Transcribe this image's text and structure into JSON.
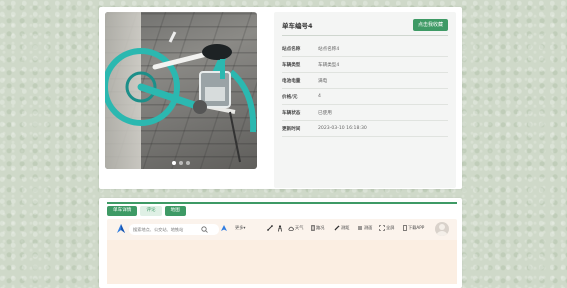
{
  "detail": {
    "title": "单车编号4",
    "collect_label": "点击我收藏",
    "fields": [
      {
        "label": "站点名称",
        "value": "站点名称4"
      },
      {
        "label": "车辆类型",
        "value": "车辆类型4"
      },
      {
        "label": "电池电量",
        "value": "满电"
      },
      {
        "label": "价格/元",
        "value": "4"
      },
      {
        "label": "车辆状态",
        "value": "已使用"
      },
      {
        "label": "更新时间",
        "value": "2023-03-10 16:18:30"
      }
    ],
    "carousel": {
      "count": 3,
      "active_index": 0
    }
  },
  "bottom": {
    "tabs": [
      {
        "label": "单车详情",
        "active": true
      },
      {
        "label": "评论",
        "active": false
      },
      {
        "label": "地图",
        "active": true
      }
    ],
    "map": {
      "search_placeholder": "搜索地点、公交站、地铁站",
      "more_label": "更多",
      "tools": [
        {
          "label": "",
          "icon": "route-icon"
        },
        {
          "label": "",
          "icon": "person-icon"
        },
        {
          "label": "天气",
          "icon": "cloud-icon"
        },
        {
          "label": "路况",
          "icon": "traffic-icon"
        },
        {
          "label": "测距",
          "icon": "ruler-icon"
        },
        {
          "label": "测面",
          "icon": "measure-area-icon"
        },
        {
          "label": "全屏",
          "icon": "fullscreen-icon"
        }
      ],
      "download_label": "下载APP"
    }
  },
  "colors": {
    "accent": "#3e9a65",
    "bike_teal": "#2bb8b0"
  }
}
